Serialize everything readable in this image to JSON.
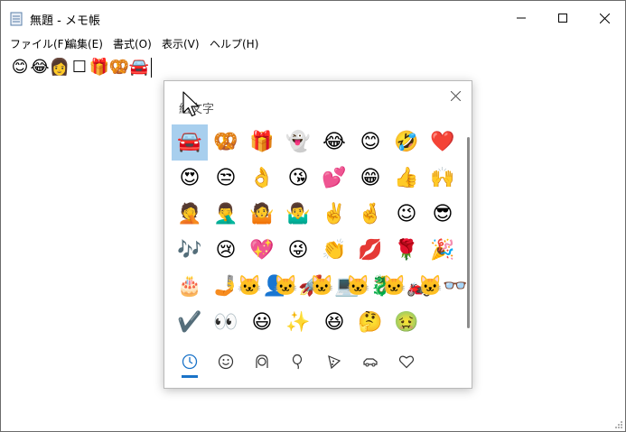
{
  "window": {
    "title": "無題 - メモ帳",
    "controls": {
      "minimize": "minimize",
      "maximize": "maximize",
      "close": "close"
    }
  },
  "menu": {
    "items": [
      "ファイル(F)",
      "編集(E)",
      "書式(O)",
      "表示(V)",
      "ヘルプ(H)"
    ]
  },
  "editor": {
    "text": [
      "😊",
      "😂",
      "👩",
      "☐",
      "🎁",
      "🥨",
      "🚘"
    ]
  },
  "emoji_panel": {
    "title": "絵文字",
    "grid": [
      [
        "🚘",
        "🥨",
        "🎁",
        "👻",
        "😂",
        "😊",
        "🤣",
        "❤️"
      ],
      [
        "😍",
        "😒",
        "👌",
        "😘",
        "💕",
        "😁",
        "👍",
        "🙌"
      ],
      [
        "🤦",
        "🤦‍♂️",
        "🤷",
        "🤷‍♂️",
        "✌️",
        "🤞",
        "😉",
        "😎"
      ],
      [
        "🎶",
        "😢",
        "💖",
        "😜",
        "👏",
        "💋",
        "🌹",
        "🎉"
      ],
      [
        "🎂",
        "🤳",
        "🐱‍👤",
        "🐱‍🚀",
        "🐱‍💻",
        "🐱‍🐉",
        "🐱‍🏍",
        "🐱‍👓"
      ],
      [
        "✔️",
        "👀",
        "😃",
        "✨",
        "😆",
        "🤔",
        "🤢",
        ""
      ]
    ],
    "selected": [
      0,
      0
    ],
    "categories": [
      "recent-icon",
      "smiley-icon",
      "people-icon",
      "balloon-icon",
      "pizza-icon",
      "car-icon",
      "heart-icon"
    ],
    "active_category": "recent-icon"
  },
  "colors": {
    "accent": "#1a73c8",
    "selection": "#a8cfee",
    "heart": "#e0243c"
  }
}
